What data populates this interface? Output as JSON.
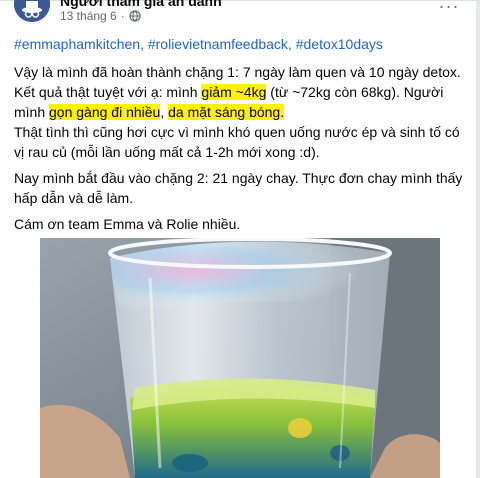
{
  "post": {
    "author": "Người tham gia ẩn danh",
    "timestamp": "13 tháng 6",
    "dot": "·",
    "more_label": "···",
    "hashtags": [
      "#emmaphamkitchen",
      "#rolievietnamfeedback",
      "#detox10days"
    ],
    "hashtag_separator": ", ",
    "paragraphs": [
      {
        "lines": [
          [
            {
              "text": "Vậy là mình đã hoàn thành chặng 1: 7 ngày làm quen và 10 ngày detox."
            }
          ],
          [
            {
              "text": "Kết quả thật tuyệt với ạ: mình "
            },
            {
              "text": "giảm ~4kg",
              "highlight": true
            },
            {
              "text": " (từ ~72kg còn 68kg). Người"
            }
          ],
          [
            {
              "text": "mình "
            },
            {
              "text": "gọn gàng đi nhiều",
              "highlight": true
            },
            {
              "text": ", "
            },
            {
              "text": "da mặt sáng bóng.",
              "highlight": true
            }
          ],
          [
            {
              "text": "Thật tình thì cũng hơi cực vì mình khó quen uống nước ép và sinh tố có"
            }
          ],
          [
            {
              "text": "vị rau củ (mỗi lần uống mất cả 1-2h mới xong :d)."
            }
          ]
        ]
      },
      {
        "lines": [
          [
            {
              "text": "Nay mình bắt đầu vào chặng 2: 21 ngày chay. Thực đơn chay mình thấy"
            }
          ],
          [
            {
              "text": "hấp dẫn và dễ làm."
            }
          ]
        ]
      },
      {
        "lines": [
          [
            {
              "text": "Cám ơn team Emma và Rolie nhiều."
            }
          ]
        ]
      }
    ],
    "highlight_color": "#fff200",
    "link_color": "#1d64cf"
  },
  "icons": {
    "avatar": "anonymous-avatar-icon",
    "privacy": "globe-icon",
    "more": "more-options-icon"
  }
}
